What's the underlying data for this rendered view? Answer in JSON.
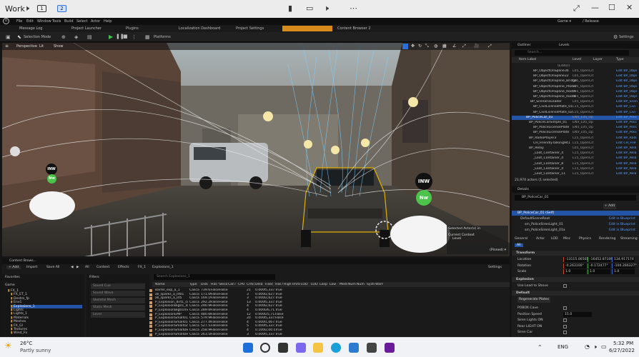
{
  "windows": {
    "workspace": "Work",
    "desktops": [
      "1",
      "2"
    ],
    "editor_title": "Game ▾",
    "build_config": "/ Release"
  },
  "menu": [
    "File",
    "Edit",
    "Window",
    "Tools",
    "Build",
    "Select",
    "Actor",
    "Help"
  ],
  "tabs": [
    "Message Log",
    "Project Launcher",
    "Plugins",
    "Localization Dashboard",
    "Project Settings",
    "Content Browser 2"
  ],
  "toolbar": {
    "mode": "Selection Mode",
    "platforms": "Platforms",
    "settings": "Settings"
  },
  "viewport": {
    "perspective": "Perspective",
    "lit": "Lit",
    "show": "Show",
    "selected_actor_label": "Selected Actor(s) in",
    "current_context": "Current Context",
    "level": "Level",
    "pinned": "(Pinned) ▾",
    "icon_labels": [
      "INW",
      "Nw",
      "INW",
      "Nw"
    ]
  },
  "outliner": {
    "tab": "Outliner",
    "tab2": "Levels",
    "search_placeholder": "Search...",
    "columns": [
      "Item Label",
      "Level",
      "Layer",
      "Type"
    ],
    "editor_row": "(Editor)",
    "rows": [
      {
        "label": "BP_ObjectOnSpline36",
        "level": "L05_OpenCit",
        "type": "Edit BP_Obje"
      },
      {
        "label": "BP_ObjectOnSpline22",
        "level": "L05_OpenCit",
        "type": "Edit BP_Obje"
      },
      {
        "label": "BP_ObjectOnSpline_Bridge",
        "level": "L05_OpenCit",
        "type": "Edit BP_Obje"
      },
      {
        "label": "BP_ObjectOnSpline_Planar",
        "level": "L05_OpenCit",
        "type": "Edit BP_Obje"
      },
      {
        "label": "BP_ObjectOnSpline_RoofA",
        "level": "L05_OpenCit",
        "type": "Edit BP_Obje"
      },
      {
        "label": "BP_ObjectOnSpline_RoofB",
        "level": "L05_OpenCit",
        "type": "Edit BP_Obje"
      },
      {
        "label": "BP_ScenarioLeader",
        "level": "L05_OpenCit",
        "type": "Edit BP_Scen"
      },
      {
        "label": "BP_CivilLicensePlate_01",
        "level": "L15_OpenCit",
        "type": "Edit BP_Civi"
      },
      {
        "label": "BP_CivilLicensePlate_02",
        "level": "L15_OpenCit",
        "type": "Edit BP_Civi"
      },
      {
        "label": "BP_PoliceCar_01",
        "level": "ENV_L05_Op",
        "type": "Edit BP_Polic"
      },
      {
        "label": "BP_PoliceCarSimple_01",
        "level": "ENV_L05_Op",
        "type": "Edit BP_Polic"
      },
      {
        "label": "BP_PoliceLicensePlate",
        "level": "ENV_L05_Op",
        "type": "Edit BP_Polic"
      },
      {
        "label": "BP_PoliceLicensePlate",
        "level": "ENV_L05_Op",
        "type": "Edit BP_Polic"
      },
      {
        "label": "BP_RadioPlayer3",
        "level": "L15_OpenCit",
        "type": "Edit BP_Radi"
      },
      {
        "label": "CH_FriendlyTalking941",
        "level": "L15_OpenCit",
        "type": "Edit CH_Frie"
      },
      {
        "label": "BP_Relay",
        "level": "L05_OpenCit",
        "type": "Edit BP_Rela"
      },
      {
        "label": "_Loot_Container_4",
        "level": "L15_OpenCit",
        "type": "Edit BP_Rela"
      },
      {
        "label": "_Loot_Container_4",
        "level": "L15_OpenCit",
        "type": "Edit BP_Rela"
      },
      {
        "label": "_Loot_Container_8",
        "level": "L15_OpenCit",
        "type": "Edit BP_Rela"
      },
      {
        "label": "_Loot_Container_4",
        "level": "L15_OpenCit",
        "type": "Edit BP_Rela"
      },
      {
        "label": "_Loot_Container_11",
        "level": "L15_OpenCit",
        "type": "Edit BP_Rela"
      }
    ],
    "footer": "21,974 actors (1 selected)"
  },
  "details": {
    "tab": "Details",
    "actor_name": "BP_PoliceCar_01",
    "add_button": "+ Add",
    "components": [
      {
        "name": "BP_PoliceCar_01 (Self)",
        "action": ""
      },
      {
        "name": "DefaultSceneRoot",
        "action": "Edit in Blueprint"
      },
      {
        "name": "sm_PoliceSirenLight_01",
        "action": "Edit in Blueprint"
      },
      {
        "name": "sm_PoliceSirenLight_01a",
        "action": "Edit in Blueprint"
      }
    ],
    "filter_tabs": [
      "General",
      "Actor",
      "LOD",
      "Misc",
      "Physics",
      "Rendering",
      "Streaming",
      "All"
    ],
    "sections": {
      "transform": "Transform",
      "explosion": "Explosion",
      "default": "Default"
    },
    "transform": [
      {
        "label": "Location",
        "values": [
          "-13115.065017",
          "-16452.871096",
          "134.917174"
        ]
      },
      {
        "label": "Rotation",
        "values": [
          "-0.263100°",
          "-0.172477°",
          "-104.266327°"
        ]
      },
      {
        "label": "Scale",
        "values": [
          "1.0",
          "1.0",
          "1.0"
        ]
      }
    ],
    "explosion_rows": [
      "Use Lead to Shove"
    ],
    "default_button": "Regenerate Plates",
    "default_rows": [
      {
        "label": "POBOX Cave",
        "value": ""
      },
      {
        "label": "Position Speed",
        "value": "15.0"
      },
      {
        "label": "Siren Lights ON",
        "value": ""
      },
      {
        "label": "Rear LIGHT ON",
        "value": ""
      },
      {
        "label": "Siren Car",
        "value": ""
      }
    ]
  },
  "content_browser": {
    "tab": "Content Brows...",
    "buttons": [
      "+ Add",
      "Import",
      "Save All"
    ],
    "path": [
      "All",
      "Content",
      "Effects",
      "FX_1",
      "Explosions_1"
    ],
    "settings": "Settings",
    "favorites": "Favorites",
    "game": "Game",
    "tree": [
      "FX_1",
      "FX_ET_1",
      "Destro_fp",
      "Env1",
      "Explosions_1",
      "Lights",
      "Lights_1",
      "Materials",
      "Meshes",
      "FX_Gl",
      "Textures",
      "Wind_Fx"
    ],
    "filters_title": "Filters",
    "filters": [
      "Sound Cue",
      "Sound Wave",
      "Skeletal Mesh",
      "Static Mesh",
      "Level"
    ],
    "search_placeholder": "Search Explosions_1",
    "columns": [
      "Name",
      "Type",
      "Disk Size",
      "Has Vertex",
      "Becomes",
      "Can be Di",
      "CPU Colli",
      "Critical B",
      "Delay",
      "Fixed Bou",
      "Has GPU",
      "High End",
      "Immortal",
      "LOD Dista",
      "LOD Meth",
      "Looping",
      "Low End",
      "Medium F",
      "Num Emit",
      "Num LOD",
      "System U",
      "Warmup"
    ],
    "rows": [
      {
        "name": "Barrel_exp_a_1",
        "type": "Cascad",
        "size": "739.617",
        "v1": "False",
        "v2": "False",
        "crit": "21",
        "delay": "0.00000",
        "fixed": "5,337.17",
        "gpu": "True"
      },
      {
        "name": "all_sparks_a_lit01",
        "type": "Cascad",
        "size": "171.092",
        "v1": "False",
        "v2": "False",
        "crit": "3",
        "delay": "0.00000",
        "fixed": "2,627.10",
        "gpu": "True"
      },
      {
        "name": "all_sparks_a_lit5",
        "type": "Cascad",
        "size": "169.196",
        "v1": "False",
        "v2": "False",
        "crit": "3",
        "delay": "0.00000",
        "fixed": "2,627.10",
        "gpu": "True"
      },
      {
        "name": "P_Explosion_dirt1_com",
        "type": "Cascad",
        "size": "292.282",
        "v1": "False",
        "v2": "False",
        "crit": "13",
        "delay": "0.00000",
        "fixed": "5,337.17",
        "gpu": "True"
      },
      {
        "name": "P_ExplosionBig01_lose",
        "type": "Cascad",
        "size": "290.962",
        "v1": "False",
        "v2": "False",
        "crit": "4",
        "delay": "0.00000",
        "fixed": "2,627.10",
        "gpu": "True"
      },
      {
        "name": "P_ExplosionBig01mega",
        "type": "Cascad",
        "size": "289.696",
        "v1": "False",
        "v2": "False",
        "crit": "4",
        "delay": "0.00000",
        "fixed": "26,711.6",
        "gpu": "True"
      },
      {
        "name": "P_ExplosionEMP",
        "type": "Cascad",
        "size": "480.600",
        "v1": "False",
        "v2": "False",
        "crit": "12",
        "delay": "0.00000",
        "fixed": "25,713.4",
        "gpu": "False"
      },
      {
        "name": "P_ExplosionSmall01_b",
        "type": "Cascad",
        "size": "579.902",
        "v1": "False",
        "v2": "False",
        "crit": "20",
        "delay": "0.00000",
        "fixed": "5,337.17",
        "gpu": "False"
      },
      {
        "name": "P_ExplosionSmall01_a",
        "type": "Cascad",
        "size": "277.498",
        "v1": "False",
        "v2": "False",
        "crit": "4",
        "delay": "0.00000",
        "fixed": "1,067.10",
        "gpu": "True"
      },
      {
        "name": "P_ExplosionSmall02fwd",
        "type": "Cascad",
        "size": "527.539",
        "v1": "False",
        "v2": "False",
        "crit": "5",
        "delay": "0.00000",
        "fixed": "5,337.17",
        "gpu": "True"
      },
      {
        "name": "P_ExplosionSmallDebris",
        "type": "Cascad",
        "size": "258.903",
        "v1": "False",
        "v2": "False",
        "crit": "4",
        "delay": "0.10000",
        "fixed": "2,00.00",
        "gpu": "True"
      },
      {
        "name": "P_ExplosionSmallDebris",
        "type": "Cascad",
        "size": "263.589",
        "v1": "False",
        "v2": "False",
        "crit": "3",
        "delay": "0.00000",
        "fixed": "5,337.17",
        "gpu": "True"
      }
    ]
  },
  "taskbar": {
    "weather_temp": "26°C",
    "weather_desc": "Partly sunny",
    "lang": "ENG",
    "time": "5:32 PM",
    "date": "6/27/2022"
  }
}
